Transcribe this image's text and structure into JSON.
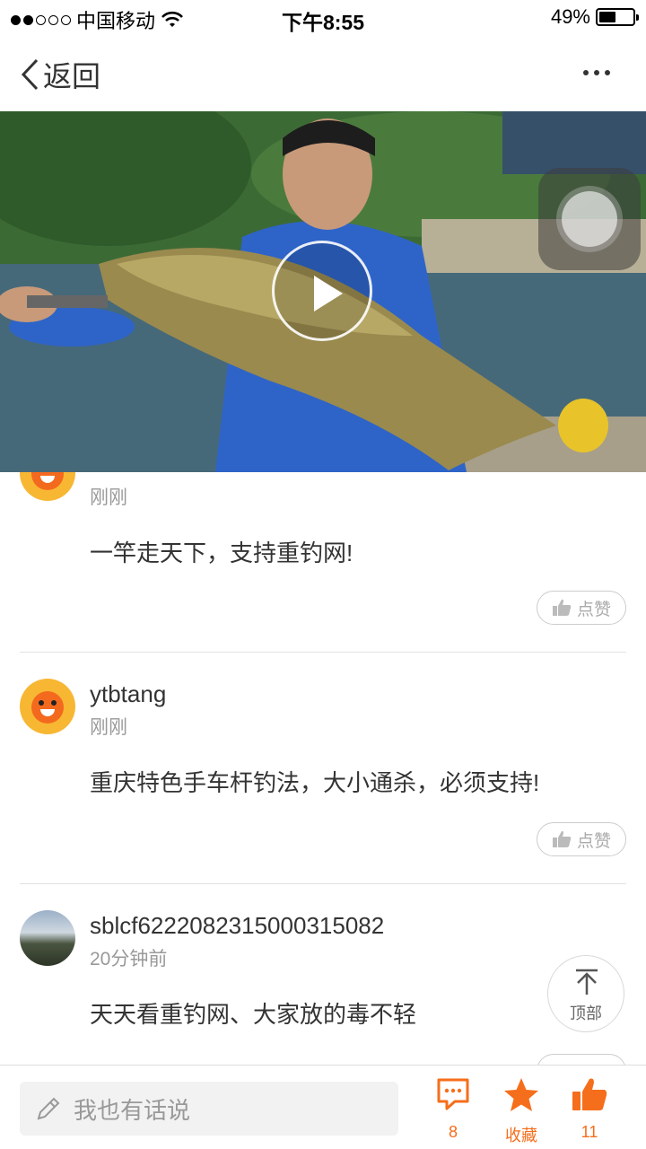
{
  "status_bar": {
    "carrier": "中国移动",
    "time": "下午8:55",
    "battery": "49%",
    "battery_level": 0.49,
    "signal_bars": 2
  },
  "nav": {
    "back_label": "返回"
  },
  "comments": [
    {
      "name": "",
      "time": "刚刚",
      "text": "一竿走天下，支持重钓网!",
      "like_label": "点赞"
    },
    {
      "name": "ytbtang",
      "time": "刚刚",
      "text": "重庆特色手车杆钓法，大小通杀，必须支持!",
      "like_label": "点赞"
    },
    {
      "name": "sblcf6222082315000315082",
      "time": "20分钟前",
      "text": "天天看重钓网、大家放的毒不轻",
      "like_label": ""
    }
  ],
  "top_button": {
    "label": "顶部"
  },
  "bottom_bar": {
    "input_placeholder": "我也有话说",
    "comment_count": "8",
    "favorite_label": "收藏",
    "like_count": "11"
  },
  "colors": {
    "accent": "#f56e1b"
  }
}
